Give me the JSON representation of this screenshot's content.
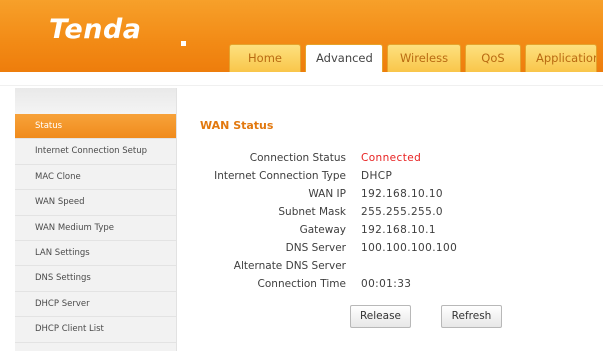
{
  "brand": {
    "logo": "Tenda"
  },
  "tabs": [
    {
      "label": "Home",
      "active": false
    },
    {
      "label": "Advanced",
      "active": true
    },
    {
      "label": "Wireless",
      "active": false
    },
    {
      "label": "QoS",
      "active": false
    },
    {
      "label": "Application",
      "active": false
    }
  ],
  "sidebar": {
    "items": [
      {
        "label": "Status",
        "active": true
      },
      {
        "label": "Internet Connection Setup",
        "active": false
      },
      {
        "label": "MAC Clone",
        "active": false
      },
      {
        "label": "WAN Speed",
        "active": false
      },
      {
        "label": "WAN Medium Type",
        "active": false
      },
      {
        "label": "LAN Settings",
        "active": false
      },
      {
        "label": "DNS Settings",
        "active": false
      },
      {
        "label": "DHCP Server",
        "active": false
      },
      {
        "label": "DHCP Client List",
        "active": false
      }
    ]
  },
  "wan_status": {
    "title": "WAN Status",
    "rows": [
      {
        "label": "Connection Status",
        "value": "Connected"
      },
      {
        "label": "Internet Connection Type",
        "value": "DHCP"
      },
      {
        "label": "WAN IP",
        "value": "192.168.10.10"
      },
      {
        "label": "Subnet Mask",
        "value": "255.255.255.0"
      },
      {
        "label": "Gateway",
        "value": "192.168.10.1"
      },
      {
        "label": "DNS Server",
        "value": "100.100.100.100"
      },
      {
        "label": "Alternate DNS Server",
        "value": ""
      },
      {
        "label": "Connection Time",
        "value": "00:01:33"
      }
    ],
    "release_label": "Release",
    "refresh_label": "Refresh"
  },
  "colors": {
    "header_orange": "#f28a15",
    "tab_yellow": "#f9c64a",
    "title_orange": "#e2780e",
    "connected_red": "#e82222"
  }
}
